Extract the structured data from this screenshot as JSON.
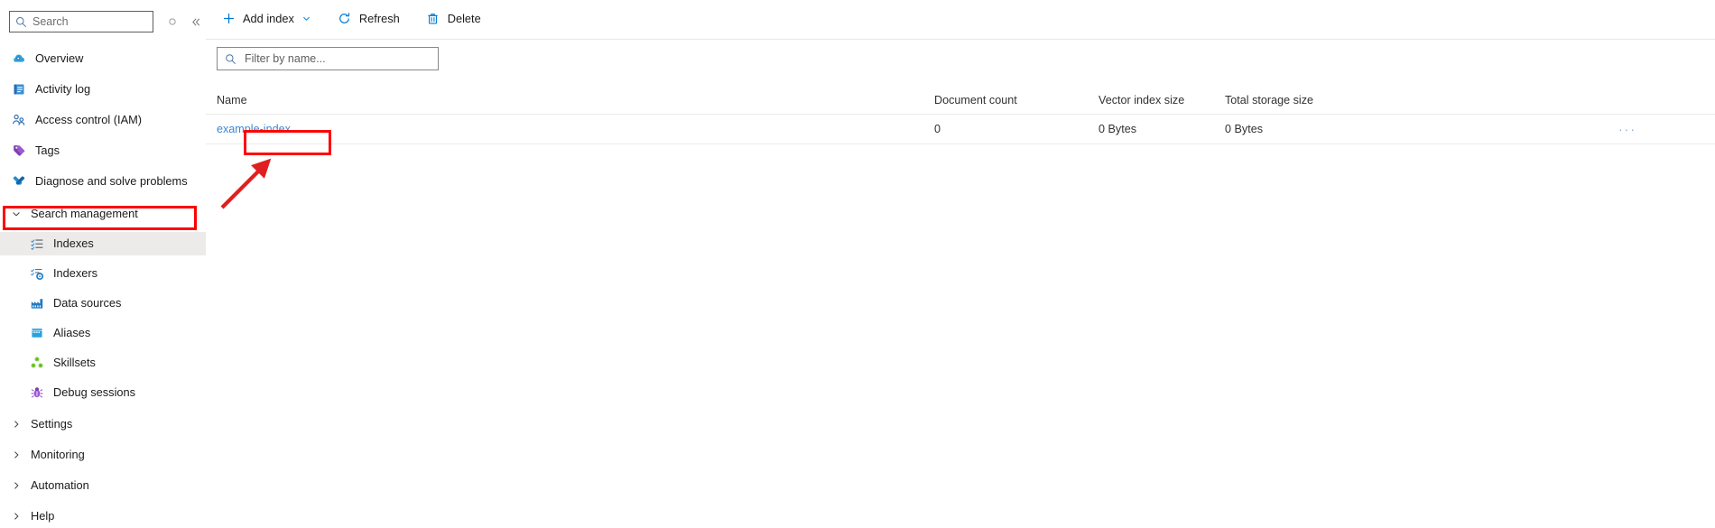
{
  "sidebar": {
    "search": {
      "placeholder": "Search",
      "icon": "search-icon"
    },
    "pin_icon": "pin-icon",
    "collapse_icon": "double-chevron-left-icon",
    "items": [
      {
        "label": "Overview",
        "icon": "cloud-overview-icon",
        "type": "item",
        "selected": false
      },
      {
        "label": "Activity log",
        "icon": "activity-log-icon",
        "type": "item",
        "selected": false
      },
      {
        "label": "Access control (IAM)",
        "icon": "people-access-icon",
        "type": "item",
        "selected": false
      },
      {
        "label": "Tags",
        "icon": "tag-icon",
        "type": "item",
        "selected": false
      },
      {
        "label": "Diagnose and solve problems",
        "icon": "wrench-cross-icon",
        "type": "item",
        "selected": false
      },
      {
        "label": "Search management",
        "icon": "chevron-down-icon",
        "type": "group",
        "selected": false
      },
      {
        "label": "Indexes",
        "icon": "indexes-icon",
        "type": "child",
        "selected": true
      },
      {
        "label": "Indexers",
        "icon": "indexers-icon",
        "type": "child",
        "selected": false
      },
      {
        "label": "Data sources",
        "icon": "data-sources-icon",
        "type": "child",
        "selected": false
      },
      {
        "label": "Aliases",
        "icon": "aliases-icon",
        "type": "child",
        "selected": false
      },
      {
        "label": "Skillsets",
        "icon": "skillsets-icon",
        "type": "child",
        "selected": false
      },
      {
        "label": "Debug sessions",
        "icon": "debug-bug-icon",
        "type": "child",
        "selected": false
      },
      {
        "label": "Settings",
        "icon": "chevron-right-icon",
        "type": "group",
        "selected": false
      },
      {
        "label": "Monitoring",
        "icon": "chevron-right-icon",
        "type": "group",
        "selected": false
      },
      {
        "label": "Automation",
        "icon": "chevron-right-icon",
        "type": "group",
        "selected": false
      },
      {
        "label": "Help",
        "icon": "chevron-right-icon",
        "type": "group",
        "selected": false
      }
    ]
  },
  "toolbar": {
    "add_index_label": "Add index",
    "add_index_icon": "plus-icon",
    "add_index_chevron": "chevron-down-icon",
    "refresh_label": "Refresh",
    "refresh_icon": "refresh-circular-arrow-icon",
    "delete_label": "Delete",
    "delete_icon": "trash-can-icon"
  },
  "filter": {
    "placeholder": "Filter by name...",
    "value": "",
    "icon": "search-icon"
  },
  "table": {
    "columns": [
      {
        "key": "name",
        "label": "Name"
      },
      {
        "key": "document_count",
        "label": "Document count"
      },
      {
        "key": "vector_index_size",
        "label": "Vector index size"
      },
      {
        "key": "total_storage_size",
        "label": "Total storage size"
      }
    ],
    "rows": [
      {
        "name": "example-index",
        "document_count": "0",
        "vector_index_size": "0 Bytes",
        "total_storage_size": "0 Bytes",
        "overflow_label": "···"
      }
    ]
  },
  "annotations": {
    "accent_color": "#ff0000",
    "highlight_sidebar_item": "Indexes",
    "highlight_table_cell": "example-index",
    "arrow": "red-arrow-pointing-from-indexes-to-example-index"
  },
  "theme": {
    "link_color": "#3b87d1",
    "accent_blue": "#0078d4",
    "selected_bg": "#edebe9"
  }
}
